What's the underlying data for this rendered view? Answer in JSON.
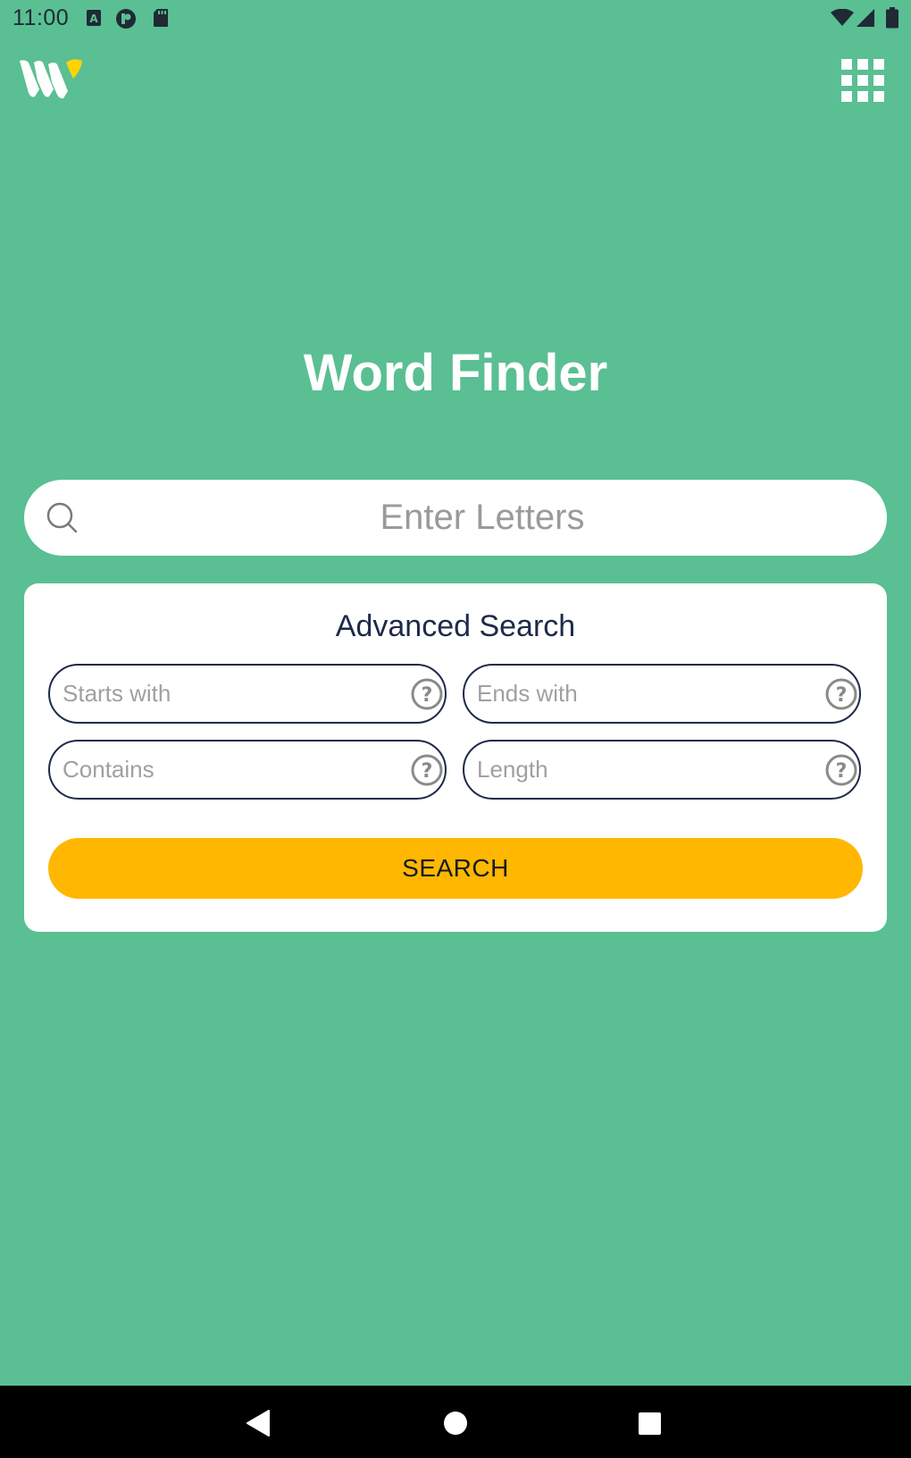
{
  "status_bar": {
    "time": "11:00",
    "left_icons": [
      "a-notification-icon",
      "pocket-casts-icon",
      "sd-card-icon"
    ],
    "right_icons": [
      "wifi-icon",
      "cell-signal-icon",
      "battery-icon"
    ]
  },
  "header": {
    "logo_icon": "w-logo-icon",
    "logo_colors": {
      "primary": "#ffffff",
      "accent": "#ffd400"
    },
    "menu_icon": "apps-grid-icon"
  },
  "title": "Word Finder",
  "search": {
    "placeholder": "Enter Letters",
    "value": ""
  },
  "advanced": {
    "title": "Advanced Search",
    "fields": [
      {
        "placeholder": "Starts with",
        "value": ""
      },
      {
        "placeholder": "Ends with",
        "value": ""
      },
      {
        "placeholder": "Contains",
        "value": ""
      },
      {
        "placeholder": "Length",
        "value": ""
      }
    ],
    "button_label": "SEARCH"
  },
  "nav_bar": {
    "buttons": [
      "back-icon",
      "home-icon",
      "recents-icon"
    ]
  },
  "colors": {
    "background": "#5abf93",
    "card": "#ffffff",
    "accent_button": "#ffb701",
    "text_dark": "#1e2a4a"
  }
}
